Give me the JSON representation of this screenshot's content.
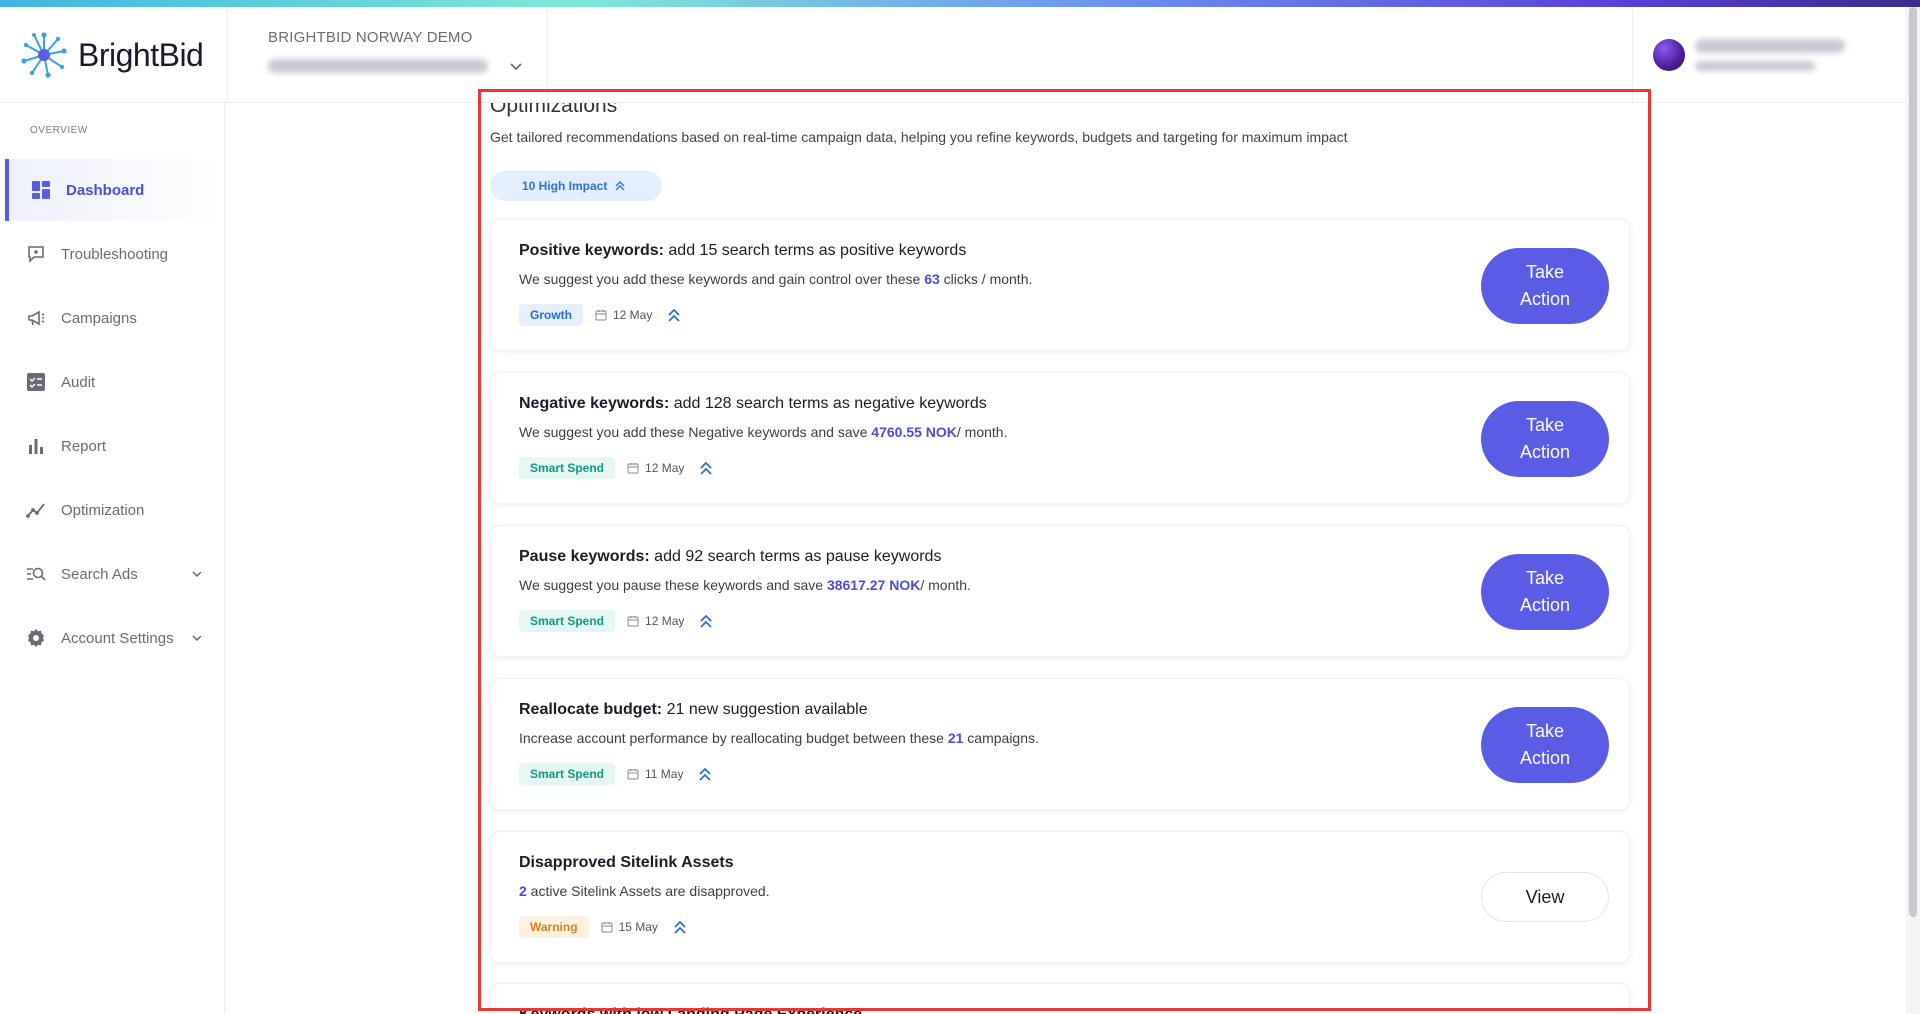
{
  "brand": {
    "name": "BrightBid",
    "accent": "#5a5ce6"
  },
  "header": {
    "account_title": "BRIGHTBID NORWAY DEMO",
    "account_select_icon": "chevron-down-icon"
  },
  "sidebar": {
    "section_label": "OVERVIEW",
    "items": [
      {
        "label": "Dashboard",
        "icon": "dashboard-icon",
        "active": true
      },
      {
        "label": "Troubleshooting",
        "icon": "troubleshooting-icon"
      },
      {
        "label": "Campaigns",
        "icon": "megaphone-icon"
      },
      {
        "label": "Audit",
        "icon": "audit-icon"
      },
      {
        "label": "Report",
        "icon": "bar-chart-icon"
      },
      {
        "label": "Optimization",
        "icon": "trend-icon"
      },
      {
        "label": "Search Ads",
        "icon": "search-ads-icon",
        "expandable": true
      },
      {
        "label": "Account Settings",
        "icon": "gear-icon",
        "expandable": true
      }
    ]
  },
  "optimizations": {
    "title": "Optimizations",
    "description": "Get tailored recommendations based on real-time campaign data, helping you refine keywords, budgets and targeting for maximum impact",
    "impact_pill": "10 High Impact",
    "cards": [
      {
        "title_bold": "Positive keywords:",
        "title_rest": " add 15 search terms as positive keywords",
        "desc_before": "We suggest you add these keywords and gain control over these ",
        "desc_highlight": "63",
        "desc_after": " clicks / month.",
        "tag": "Growth",
        "date": "12 May",
        "action": "Take Action"
      },
      {
        "title_bold": "Negative keywords:",
        "title_rest": " add 128 search terms as negative keywords",
        "desc_before": "We suggest you add these Negative keywords and save ",
        "desc_highlight": "4760.55 NOK",
        "desc_after": "/ month.",
        "tag": "Smart Spend",
        "date": "12 May",
        "action": "Take Action"
      },
      {
        "title_bold": "Pause keywords:",
        "title_rest": " add 92 search terms as pause keywords",
        "desc_before": "We suggest you pause these keywords and save ",
        "desc_highlight": "38617.27 NOK",
        "desc_after": "/ month.",
        "tag": "Smart Spend",
        "date": "12 May",
        "action": "Take Action"
      },
      {
        "title_bold": "Reallocate budget:",
        "title_rest": " 21 new suggestion available",
        "desc_before": "Increase account performance by reallocating budget between these ",
        "desc_highlight": "21",
        "desc_after": " campaigns.",
        "tag": "Smart Spend",
        "date": "11 May",
        "action": "Take Action"
      },
      {
        "title_bold": "Disapproved Sitelink Assets",
        "title_rest": "",
        "desc_before": "",
        "desc_highlight": "2",
        "desc_after": " active Sitelink Assets are disapproved.",
        "tag": "Warning",
        "date": "15 May",
        "action": "View"
      }
    ],
    "partial_card_title": "Keywords with low Landing Page Experience"
  },
  "colors": {
    "growth": "#2a6ad4",
    "smart_spend": "#129a82",
    "warning": "#d98219",
    "highlight_box": "#e53935"
  }
}
